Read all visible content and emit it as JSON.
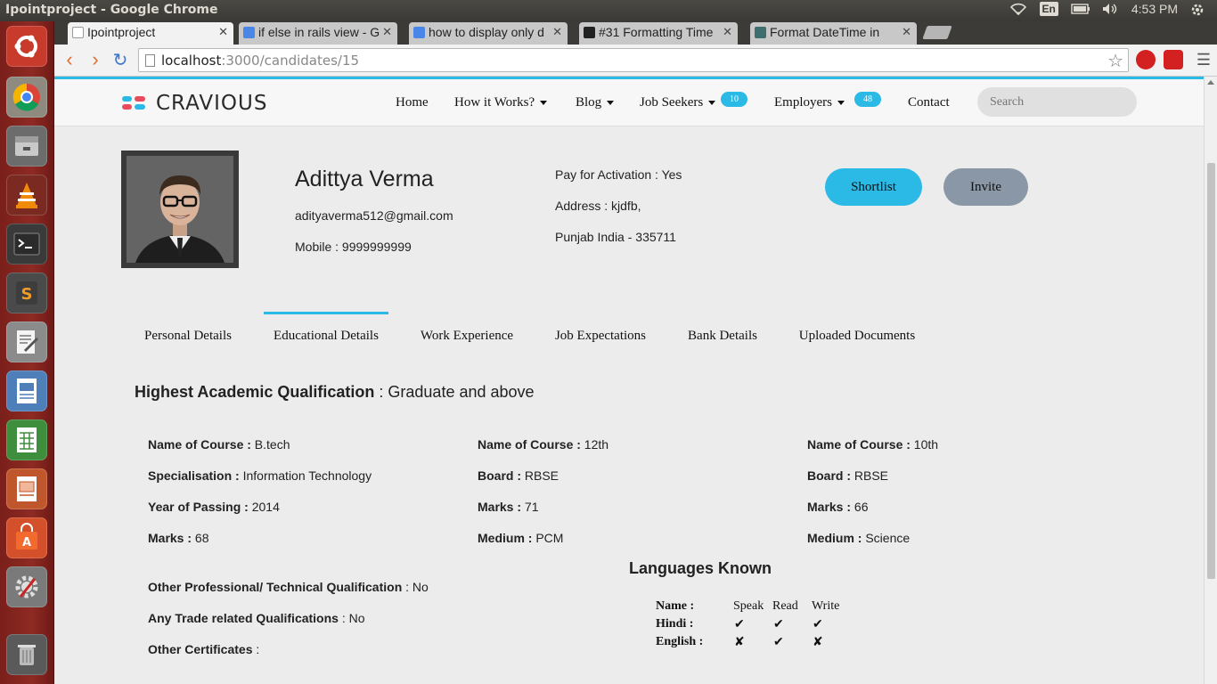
{
  "os": {
    "window_title": "Ipointproject - Google Chrome",
    "keyboard_layout": "En",
    "clock": "4:53 PM",
    "launcher": [
      "ubuntu-icon",
      "chrome-icon",
      "files-icon",
      "vlc-icon",
      "terminal-icon",
      "sublime-icon",
      "text-editor-icon",
      "writer-icon",
      "calc-icon",
      "impress-icon",
      "software-center-icon",
      "settings-icon",
      "trash-icon"
    ]
  },
  "browser": {
    "tabs": [
      {
        "label": "Ipointproject",
        "favicon": "#999999",
        "active": true
      },
      {
        "label": "if else in rails view - G",
        "favicon": "#4a86e8",
        "active": false
      },
      {
        "label": "how to display only d",
        "favicon": "#4a86e8",
        "active": false
      },
      {
        "label": "#31 Formatting Time",
        "favicon": "#222222",
        "active": false
      },
      {
        "label": "Format DateTime in",
        "favicon": "#3f6e6e",
        "active": false
      }
    ],
    "url_host": "localhost",
    "url_rest": ":3000/candidates/15"
  },
  "site": {
    "brand": "CRAVIOUS",
    "brand_colors": {
      "accent": "#2bb9e6",
      "logo_red": "#e84c5c"
    },
    "nav": {
      "home": "Home",
      "how_it_works": "How it Works?",
      "blog": "Blog",
      "job_seekers": "Job Seekers",
      "job_seekers_count": "10",
      "employers": "Employers",
      "employers_count": "48",
      "contact": "Contact"
    },
    "search_placeholder": "Search"
  },
  "candidate": {
    "name": "Adittya Verma",
    "email": "adityaverma512@gmail.com",
    "mobile": "Mobile : 9999999999",
    "pay_for_activation": "Pay for Activation : Yes",
    "address": "Address : kjdfb,",
    "location": "Punjab India - 335711",
    "shortlist_label": "Shortlist",
    "invite_label": "Invite"
  },
  "profile_tabs": [
    "Personal Details",
    "Educational Details",
    "Work Experience",
    "Job Expectations",
    "Bank Details",
    "Uploaded Documents"
  ],
  "education": {
    "highest_label": "Highest Academic Qualification",
    "highest_value": " : Graduate and above",
    "graduation": {
      "course_label": "Name of Course :",
      "course": " B.tech",
      "spec_label": "Specialisation :",
      "spec": " Information Technology",
      "year_label": "Year of Passing :",
      "year": " 2014",
      "marks_label": "Marks :",
      "marks": " 68"
    },
    "twelfth": {
      "course_label": "Name of Course :",
      "course": " 12th",
      "board_label": "Board :",
      "board": " RBSE",
      "marks_label": "Marks :",
      "marks": " 71",
      "medium_label": "Medium :",
      "medium": " PCM"
    },
    "tenth": {
      "course_label": "Name of Course :",
      "course": " 10th",
      "board_label": "Board :",
      "board": " RBSE",
      "marks_label": "Marks :",
      "marks": " 66",
      "medium_label": "Medium :",
      "medium": " Science"
    },
    "other_prof_label": "Other Professional/ Technical Qualification",
    "other_prof": " : No",
    "trade_label": "Any Trade related Qualifications",
    "trade": " : No",
    "certs_label": "Other Certificates",
    "certs": " :"
  },
  "languages": {
    "title": "Languages Known",
    "header": {
      "name": "Name :",
      "speak": "Speak",
      "read": "Read",
      "write": "Write"
    },
    "rows": [
      {
        "name": "Hindi :",
        "speak": "✔",
        "read": "✔",
        "write": "✔"
      },
      {
        "name": "English :",
        "speak": "✘",
        "read": "✔",
        "write": "✘"
      }
    ]
  }
}
